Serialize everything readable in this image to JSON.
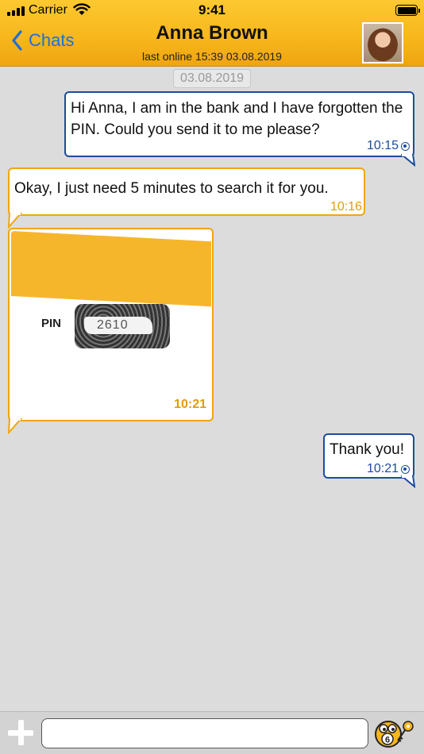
{
  "status_bar": {
    "carrier": "Carrier",
    "time": "9:41"
  },
  "header": {
    "back_label": "Chats",
    "contact_name": "Anna Brown",
    "last_online": "last online 15:39 03.08.2019"
  },
  "chat": {
    "date_separator": "03.08.2019",
    "messages": [
      {
        "direction": "outgoing",
        "text": "Hi Anna, I am in the bank and I have forgotten the PIN. Could you send it to me please?",
        "time": "10:15",
        "status": "read"
      },
      {
        "direction": "incoming",
        "text": "Okay, I just need 5 minutes to search it for you.",
        "time": "10:16"
      },
      {
        "direction": "incoming",
        "type": "photo",
        "photo_label": "PIN",
        "photo_code": "2610",
        "time": "10:21"
      },
      {
        "direction": "outgoing",
        "text": "Thank you!",
        "time": "10:21",
        "status": "read"
      }
    ]
  },
  "composer": {
    "input_value": "",
    "badge_count": "6"
  },
  "colors": {
    "accent": "#f7b61c",
    "outgoing_border": "#1c4c9c",
    "incoming_border": "#f0a60a",
    "link": "#1e6fd6"
  },
  "icons": {
    "back": "chevron-left-icon",
    "add": "plus-icon",
    "mascot": "mascot-key-icon",
    "wifi": "wifi-icon",
    "battery": "battery-icon",
    "signal": "signal-icon"
  }
}
